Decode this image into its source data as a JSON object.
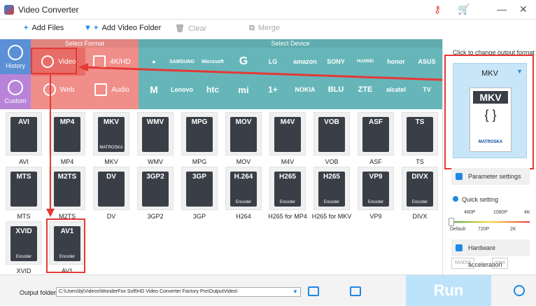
{
  "window": {
    "title": "Video Converter"
  },
  "toolbar": {
    "add_files": "Add Files",
    "add_video_folder": "Add Video Folder",
    "clear": "Clear",
    "merge": "Merge"
  },
  "sidebar": {
    "history": "History",
    "custom": "Custom"
  },
  "format_panel": {
    "header": "Select Format",
    "video": "Video",
    "hd": "4K/HD",
    "web": "Web",
    "audio": "Audio"
  },
  "device_panel": {
    "header": "Select Device",
    "row1": [
      "",
      "SAMSUNG",
      "Microsoft",
      "G",
      "LG",
      "amazon",
      "SONY",
      "HUAWEI",
      "honor",
      "ASUS"
    ],
    "row2": [
      "M",
      "Lenovo",
      "htc",
      "mi",
      "1+",
      "NOKIA",
      "BLU",
      "ZTE",
      "alcatel",
      "TV"
    ]
  },
  "formats": [
    {
      "tag": "AVI",
      "sub": "",
      "label": "AVI"
    },
    {
      "tag": "MP4",
      "sub": "",
      "label": "MP4"
    },
    {
      "tag": "MKV",
      "sub": "MATROSKA",
      "label": "MKV"
    },
    {
      "tag": "WMV",
      "sub": "",
      "label": "WMV"
    },
    {
      "tag": "MPG",
      "sub": "",
      "label": "MPG"
    },
    {
      "tag": "MOV",
      "sub": "",
      "label": "MOV"
    },
    {
      "tag": "M4V",
      "sub": "",
      "label": "M4V"
    },
    {
      "tag": "VOB",
      "sub": "",
      "label": "VOB"
    },
    {
      "tag": "ASF",
      "sub": "",
      "label": "ASF"
    },
    {
      "tag": "TS",
      "sub": "",
      "label": "TS"
    },
    {
      "tag": "MTS",
      "sub": "",
      "label": "MTS"
    },
    {
      "tag": "M2TS",
      "sub": "",
      "label": "M2TS"
    },
    {
      "tag": "DV",
      "sub": "",
      "label": "DV"
    },
    {
      "tag": "3GP2",
      "sub": "",
      "label": "3GP2"
    },
    {
      "tag": "3GP",
      "sub": "",
      "label": "3GP"
    },
    {
      "tag": "H.264",
      "sub": "Encoder",
      "label": "H264"
    },
    {
      "tag": "H265",
      "sub": "Encoder",
      "label": "H265 for MP4"
    },
    {
      "tag": "H265",
      "sub": "Encoder",
      "label": "H265 for MKV"
    },
    {
      "tag": "VP9",
      "sub": "Encoder",
      "label": "VP9"
    },
    {
      "tag": "DIVX",
      "sub": "Encoder",
      "label": "DIVX"
    },
    {
      "tag": "XVID",
      "sub": "Encoder",
      "label": "XVID"
    },
    {
      "tag": "AV1",
      "sub": "Encoder",
      "label": "AV1"
    }
  ],
  "output": {
    "hint": "Click to change output format",
    "format": "MKV",
    "icon_tag": "MKV",
    "icon_sub": "MATROSKA"
  },
  "right_panel": {
    "parameter_settings": "Parameter settings",
    "quick_setting": "Quick setting",
    "slider_top": [
      "480P",
      "1080P",
      "4K"
    ],
    "slider_bottom": [
      "Default",
      "720P",
      "2K"
    ],
    "hardware_acceleration": "Hardware acceleration",
    "nvidia": "NVIDIA",
    "intel": "Intel"
  },
  "bottom": {
    "output_folder_label": "Output folder:",
    "path": "C:\\Users\\bj\\Videos\\WonderFox Soft\\HD Video Converter Factory Pro\\OutputVideo\\",
    "run": "Run"
  },
  "colors": {
    "format_panel": "#f08e8a",
    "device_panel": "#66b6b9",
    "accent": "#1e88e5",
    "highlight": "#e53935",
    "run_button": "#bde3fb"
  }
}
